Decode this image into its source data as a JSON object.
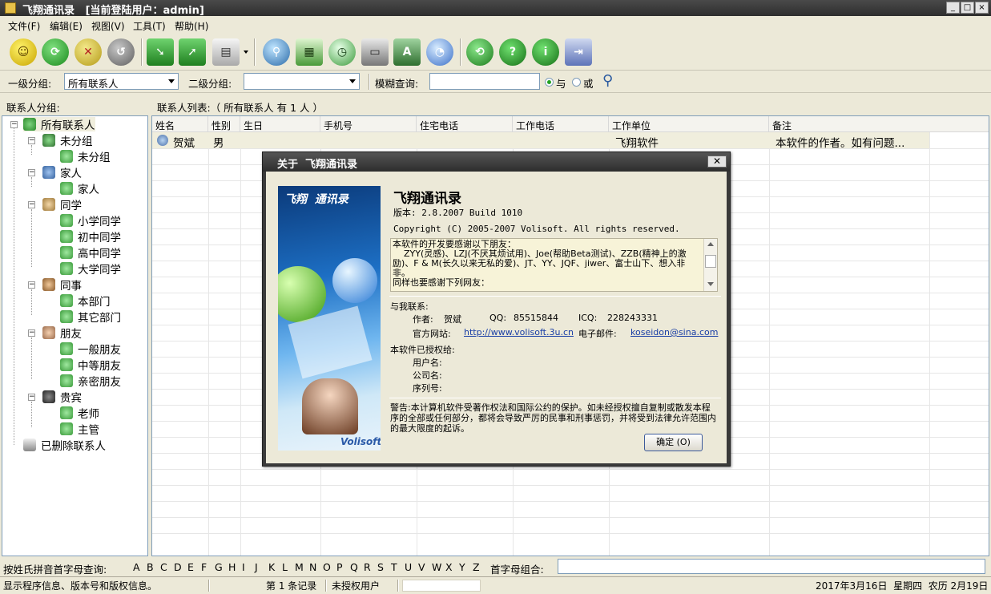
{
  "window": {
    "title": "飞翔通讯录   [当前登陆用户：admin]",
    "min": "_",
    "max": "□",
    "close": "×"
  },
  "menu": [
    "文件(F)",
    "编辑(E)",
    "视图(V)",
    "工具(T)",
    "帮助(H)"
  ],
  "toolbar": {
    "icons": [
      "smiley-icon",
      "refresh-green-icon",
      "delete-x-icon",
      "restore-icon",
      "import-arrow-icon",
      "export-arrow-icon",
      "printer-icon",
      "search-magnifier-icon",
      "calendar-icon",
      "clock-icon",
      "computer-icon",
      "book-icon",
      "pie-chart-icon",
      "refresh-icon",
      "help-icon",
      "info-icon",
      "exit-door-icon"
    ]
  },
  "filter": {
    "group1_label": "一级分组:",
    "group1_value": "所有联系人",
    "group2_label": "二级分组:",
    "group2_value": "",
    "fuzzy_label": "模糊查询:",
    "fuzzy_value": "",
    "and_label": "与",
    "or_label": "或"
  },
  "panes": {
    "tree_header": "联系人分组:",
    "list_header": "联系人列表:（ 所有联系人 有 1 人 ）"
  },
  "tree": [
    {
      "label": "所有联系人",
      "level": 0,
      "selected": true
    },
    {
      "label": "未分组",
      "level": 1
    },
    {
      "label": "未分组",
      "level": 2
    },
    {
      "label": "家人",
      "level": 1
    },
    {
      "label": "家人",
      "level": 2
    },
    {
      "label": "同学",
      "level": 1
    },
    {
      "label": "小学同学",
      "level": 2
    },
    {
      "label": "初中同学",
      "level": 2
    },
    {
      "label": "高中同学",
      "level": 2
    },
    {
      "label": "大学同学",
      "level": 2
    },
    {
      "label": "同事",
      "level": 1
    },
    {
      "label": "本部门",
      "level": 2
    },
    {
      "label": "其它部门",
      "level": 2
    },
    {
      "label": "朋友",
      "level": 1
    },
    {
      "label": "一般朋友",
      "level": 2
    },
    {
      "label": "中等朋友",
      "level": 2
    },
    {
      "label": "亲密朋友",
      "level": 2
    },
    {
      "label": "贵宾",
      "level": 1
    },
    {
      "label": "老师",
      "level": 2
    },
    {
      "label": "主管",
      "level": 2
    },
    {
      "label": "已删除联系人",
      "level": 0
    }
  ],
  "grid": {
    "columns": [
      "姓名",
      "性别",
      "生日",
      "手机号",
      "住宅电话",
      "工作电话",
      "工作单位",
      "备注"
    ],
    "rows": [
      [
        "贺斌",
        "男",
        "",
        "",
        "",
        "",
        "飞翔软件",
        "本软件的作者。如有问题..."
      ]
    ]
  },
  "alpha": {
    "label": "按姓氏拼音首字母查询:",
    "letters": [
      "A",
      "B",
      "C",
      "D",
      "E",
      "F",
      "G",
      "H",
      "I",
      "J",
      "K",
      "L",
      "M",
      "N",
      "O",
      "P",
      "Q",
      "R",
      "S",
      "T",
      "U",
      "V",
      "W",
      "X",
      "Y",
      "Z"
    ],
    "combo_label": "首字母组合:",
    "combo_value": ""
  },
  "status": {
    "hint": "显示程序信息、版本号和版权信息。",
    "records": "第 1 条记录",
    "license": "未授权用户",
    "date": "2017年3月16日  星期四  农历 2月19日"
  },
  "about": {
    "title": "关于  飞翔通讯录",
    "app_name": "飞翔通讯录",
    "logo_text": "飞翔  通讯录",
    "splash_brand": "Volisoft",
    "version": "版本: 2.8.2007 Build 1010",
    "copyright": "Copyright (C) 2005-2007 Volisoft. All rights reserved.",
    "thanks_lines": [
      "本软件的开发要感谢以下朋友：",
      "    ZYY(灵感)、LZJ(不厌其烦试用)、Joe(帮助Beta测试)、ZZB(精神上的激励)、F & M(长久以来无私的爱)、JT、YY、JQF、jiwer、富士山下、想入非非。",
      "同样也要感谢下列网友："
    ],
    "contact_label": "与我联系:",
    "author_label": "作者:",
    "author": "贺斌",
    "qq_label": "QQ:",
    "qq": "85515844",
    "icq_label": "ICQ:",
    "icq": "228243331",
    "site_label": "官方网站:",
    "site": "http://www.volisoft.3u.cn",
    "email_label": "电子邮件:",
    "email": "koseidon@sina.com",
    "licensed_label": "本软件已授权给:",
    "user_label": "用户名:",
    "company_label": "公司名:",
    "serial_label": "序列号:",
    "warning": "警告:本计算机软件受著作权法和国际公约的保护。如未经授权擅自复制或散发本程序的全部或任何部分，都将会导致严厉的民事和刑事惩罚，并将受到法律允许范围内的最大限度的起诉。",
    "ok_label": "确定 (O)"
  }
}
